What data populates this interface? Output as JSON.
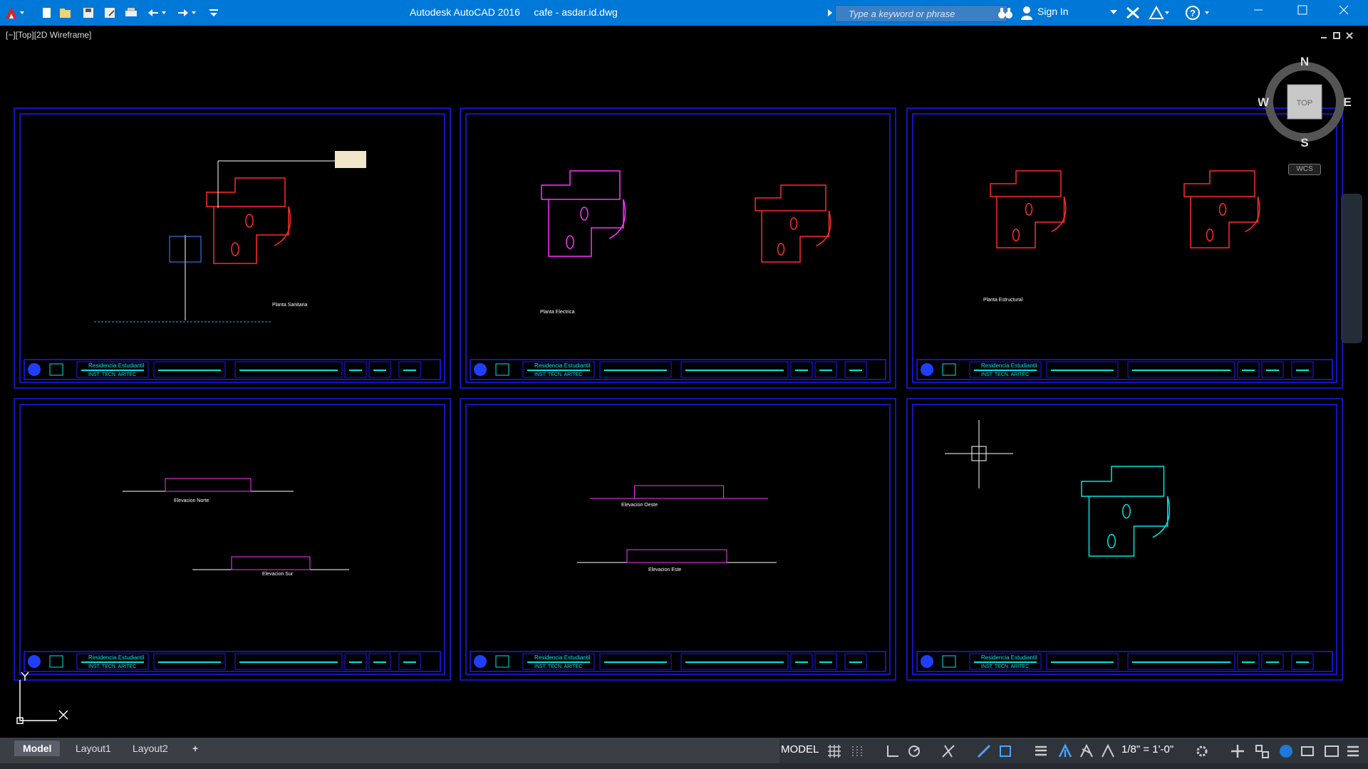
{
  "app": {
    "title": "Autodesk AutoCAD 2016",
    "filename": "cafe - asdar.id.dwg",
    "title_full": "Autodesk AutoCAD 2016     cafe - asdar.id.dwg"
  },
  "search": {
    "placeholder": "Type a keyword or phrase"
  },
  "account": {
    "sign_in_label": "Sign In"
  },
  "viewport": {
    "label": "[−][Top][2D Wireframe]"
  },
  "viewcube": {
    "north": "N",
    "south": "S",
    "east": "E",
    "west": "W",
    "face": "TOP",
    "ucs_label": "WCS"
  },
  "ucs": {
    "y_label": "Y",
    "x_label": "X"
  },
  "drawing": {
    "sheet_labels": [
      "Planta Sanitaria",
      "Planta Electrica",
      "Planta Estructural",
      "Elevacion Norte",
      "Elevacion Sur",
      "Elevacion Oeste",
      "Elevacion Este"
    ],
    "title_block": {
      "project": "Residencia Estudiantil",
      "institute": "INST. TECN. ARITEC"
    }
  },
  "tabs": [
    {
      "label": "Model",
      "active": true
    },
    {
      "label": "Layout1",
      "active": false
    },
    {
      "label": "Layout2",
      "active": false
    }
  ],
  "add_tab": "+",
  "status": {
    "model_label": "MODEL",
    "scale": "1/8\" = 1'-0\""
  },
  "icons": [
    "autocad-logo-icon",
    "new-icon",
    "open-icon",
    "save-icon",
    "saveas-icon",
    "plot-icon",
    "undo-icon",
    "redo-icon",
    "binoculars-icon",
    "user-icon",
    "exchange-icon",
    "a360-icon",
    "help-icon",
    "grid-icon",
    "snap-icon",
    "ortho-icon",
    "polar-icon",
    "osnap-icon",
    "lineweight-icon",
    "annotation-icon",
    "workspace-icon",
    "fullscreen-icon",
    "customize-icon"
  ],
  "colors": {
    "titlebar": "#0078d7",
    "canvas": "#000000",
    "frame": "#1a1aff",
    "cyan": "#00e5e5",
    "red": "#ff2a2a",
    "magenta": "#ff33ff"
  }
}
